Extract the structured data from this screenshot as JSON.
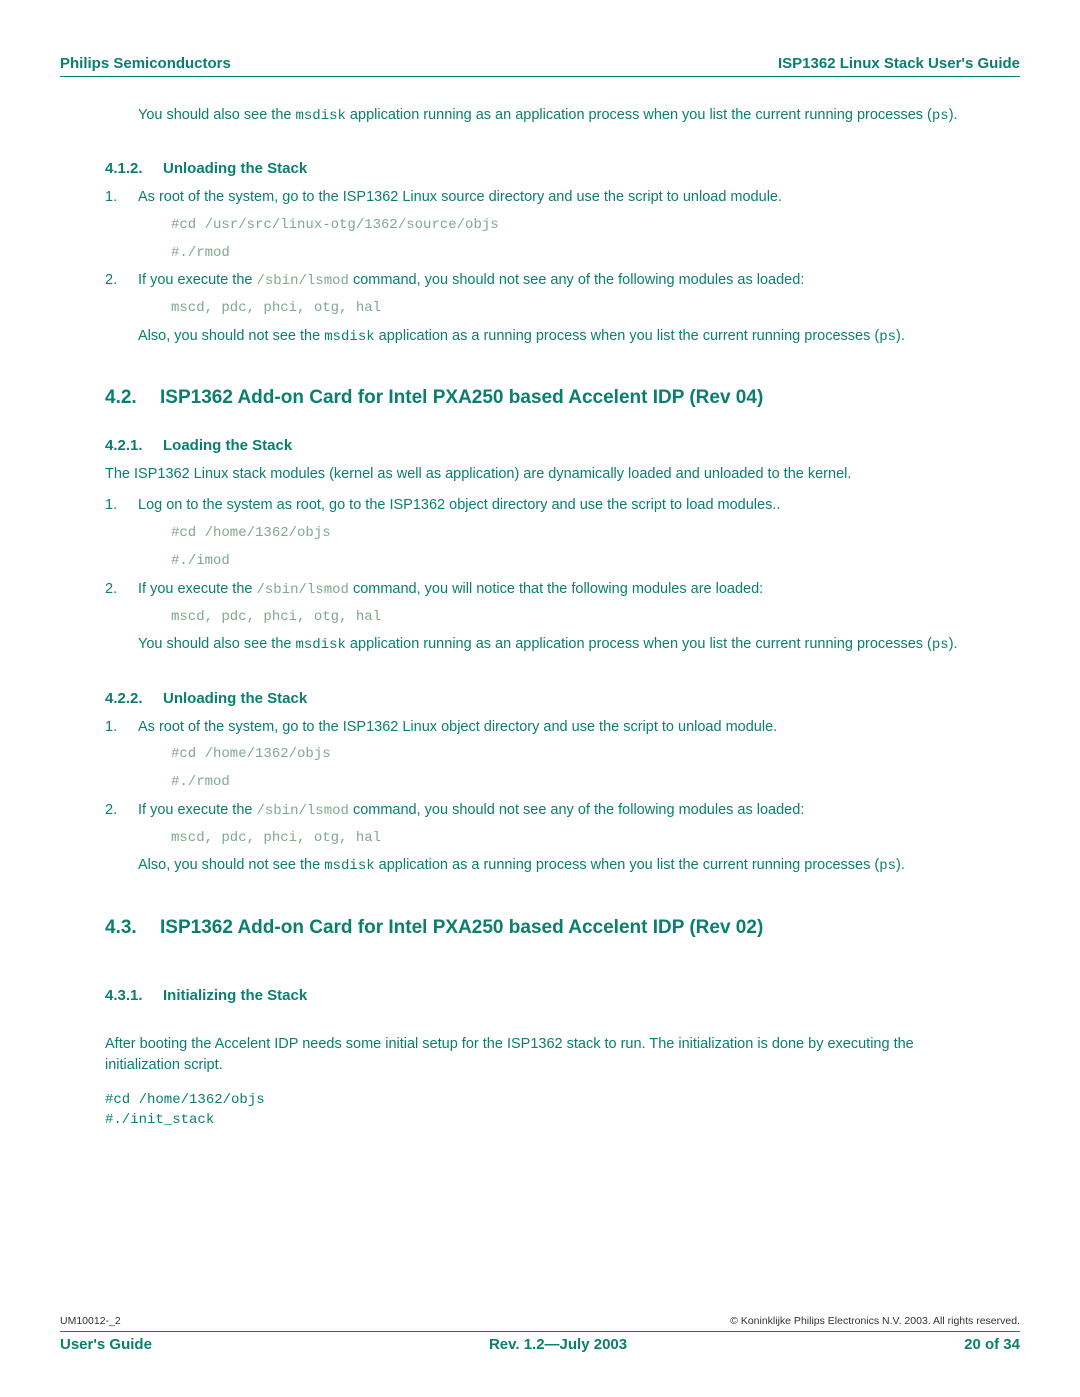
{
  "header": {
    "left": "Philips Semiconductors",
    "right": "ISP1362 Linux Stack User's Guide"
  },
  "top_para_a": "You should also see the ",
  "top_para_b": " application running as an application process when you list the current running processes (",
  "top_para_c": ").",
  "code_msdisk": "msdisk",
  "code_ps": "ps",
  "s412": {
    "num": "4.1.2.",
    "title": "Unloading the Stack"
  },
  "s412_step1": "As root of the system, go to the ISP1362 Linux source directory and use the script to unload module.",
  "s412_cd": "#cd /usr/src/linux-otg/1362/source/objs",
  "s412_rmod": "#./rmod",
  "s412_step2_a": "If you execute the ",
  "s412_step2_b": "  command, you should not see any of the following modules as loaded:",
  "code_lsmod": "/sbin/lsmod",
  "modules": "mscd, pdc, phci, otg, hal",
  "s412_after_a": "Also, you should not see the ",
  "s412_after_b": " application as a running process when you list the current running processes (",
  "s42": {
    "num": "4.2.",
    "title": "ISP1362 Add-on Card for Intel PXA250 based Accelent IDP (Rev 04)"
  },
  "s421": {
    "num": "4.2.1.",
    "title": "Loading the Stack"
  },
  "s421_intro": "The ISP1362 Linux stack modules (kernel as well as application) are dynamically loaded and unloaded to the kernel.",
  "s421_step1": "Log on to the system as root, go to the ISP1362 object directory and use the script to load modules..",
  "s421_cd": "#cd /home/1362/objs",
  "s421_imod": "#./imod",
  "s421_step2_b": "  command, you will notice that the following modules are loaded:",
  "s421_after_a": "You should also see the ",
  "s421_after_b": " application running as an application process when you list the current running processes (",
  "s422": {
    "num": "4.2.2.",
    "title": "Unloading the Stack"
  },
  "s422_step1": "As root of the system, go to the ISP1362 Linux object directory and use the script to unload module.",
  "s422_cd": "#cd /home/1362/objs",
  "s422_rmod": "#./rmod",
  "s422_after_a": "Also, you should not see the ",
  "s422_after_b": " application as a running process when you list the current running processes (",
  "s43": {
    "num": "4.3.",
    "title": "ISP1362 Add-on Card for Intel PXA250 based Accelent IDP (Rev 02)"
  },
  "s431": {
    "num": "4.3.1.",
    "title": "Initializing the Stack"
  },
  "s431_intro": "After booting the Accelent IDP needs some initial setup for the ISP1362 stack to run. The initialization is done by executing the initialization script.",
  "s431_code": "#cd /home/1362/objs\n#./init_stack",
  "footer": {
    "docid": "UM10012-_2",
    "copyright": "© Koninklijke Philips Electronics N.V. 2003. All rights reserved.",
    "left": "User's Guide",
    "center": "Rev. 1.2—July 2003",
    "right": "20 of 34"
  },
  "numbers": {
    "one": "1.",
    "two": "2."
  }
}
